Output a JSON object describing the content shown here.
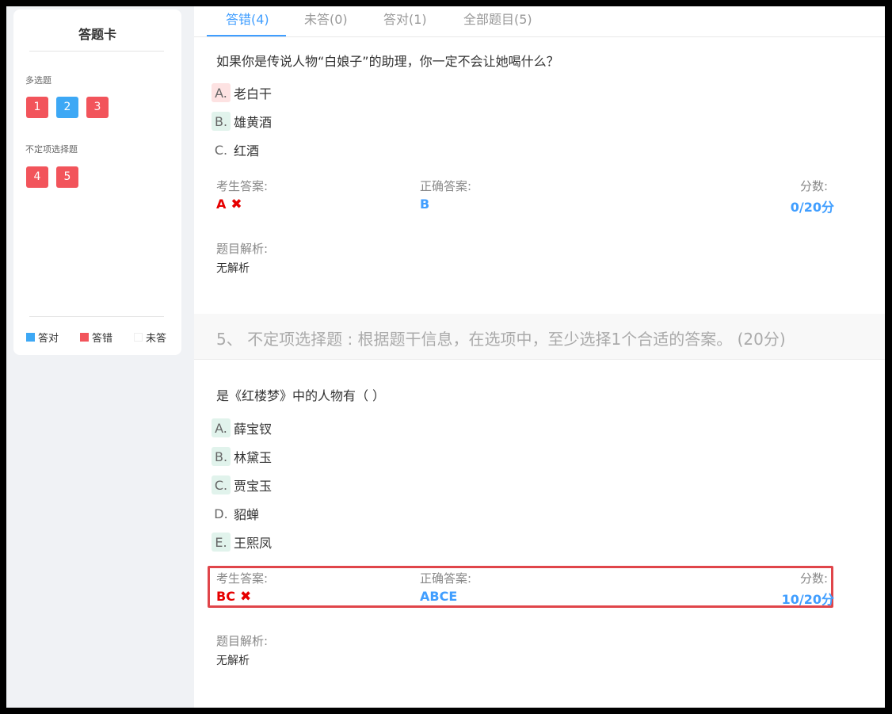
{
  "answer_card": {
    "title": "答题卡",
    "groups": [
      {
        "label": "多选题",
        "numbers": [
          "1",
          "2",
          "3"
        ]
      },
      {
        "label": "不定项选择题",
        "numbers": [
          "4",
          "5"
        ]
      }
    ],
    "legend": {
      "correct": "答对",
      "wrong": "答错",
      "unanswered": "未答"
    }
  },
  "colors": {
    "correct": "#409eff",
    "wrong": "#f2545b",
    "accent": "#409eff",
    "error_text": "#e60000",
    "highlight_border": "#e0454a"
  },
  "tabs": [
    {
      "label": "答错(4)",
      "active": true
    },
    {
      "label": "未答(0)",
      "active": false
    },
    {
      "label": "答对(1)",
      "active": false
    },
    {
      "label": "全部题目(5)",
      "active": false
    }
  ],
  "question4": {
    "text": "如果你是传说人物“白娘子”的助理，你一定不会让她喝什么？",
    "options": [
      {
        "letter": "A.",
        "text": "老白干"
      },
      {
        "letter": "B.",
        "text": "雄黄酒"
      },
      {
        "letter": "C.",
        "text": "红酒"
      }
    ],
    "student_answer_label": "考生答案:",
    "student_answer": "A",
    "correct_answer_label": "正确答案:",
    "correct_answer": "B",
    "score_label": "分数:",
    "score": "0/20分",
    "analysis_label": "题目解析:",
    "analysis": "无解析"
  },
  "section5": {
    "title": "5、 不定项选择题 : 根据题干信息，在选项中，至少选择1个合适的答案。 (20分)"
  },
  "question5": {
    "text": "是《红楼梦》中的人物有（    ）",
    "options": [
      {
        "letter": "A.",
        "text": "薛宝钗"
      },
      {
        "letter": "B.",
        "text": "林黛玉"
      },
      {
        "letter": "C.",
        "text": "贾宝玉"
      },
      {
        "letter": "D.",
        "text": "貂蝉"
      },
      {
        "letter": "E.",
        "text": "王熙凤"
      }
    ],
    "student_answer_label": "考生答案:",
    "student_answer": "BC",
    "correct_answer_label": "正确答案:",
    "correct_answer": "ABCE",
    "score_label": "分数:",
    "score": "10/20分",
    "analysis_label": "题目解析:",
    "analysis": "无解析"
  },
  "icons": {
    "wrong_mark": "✖"
  }
}
